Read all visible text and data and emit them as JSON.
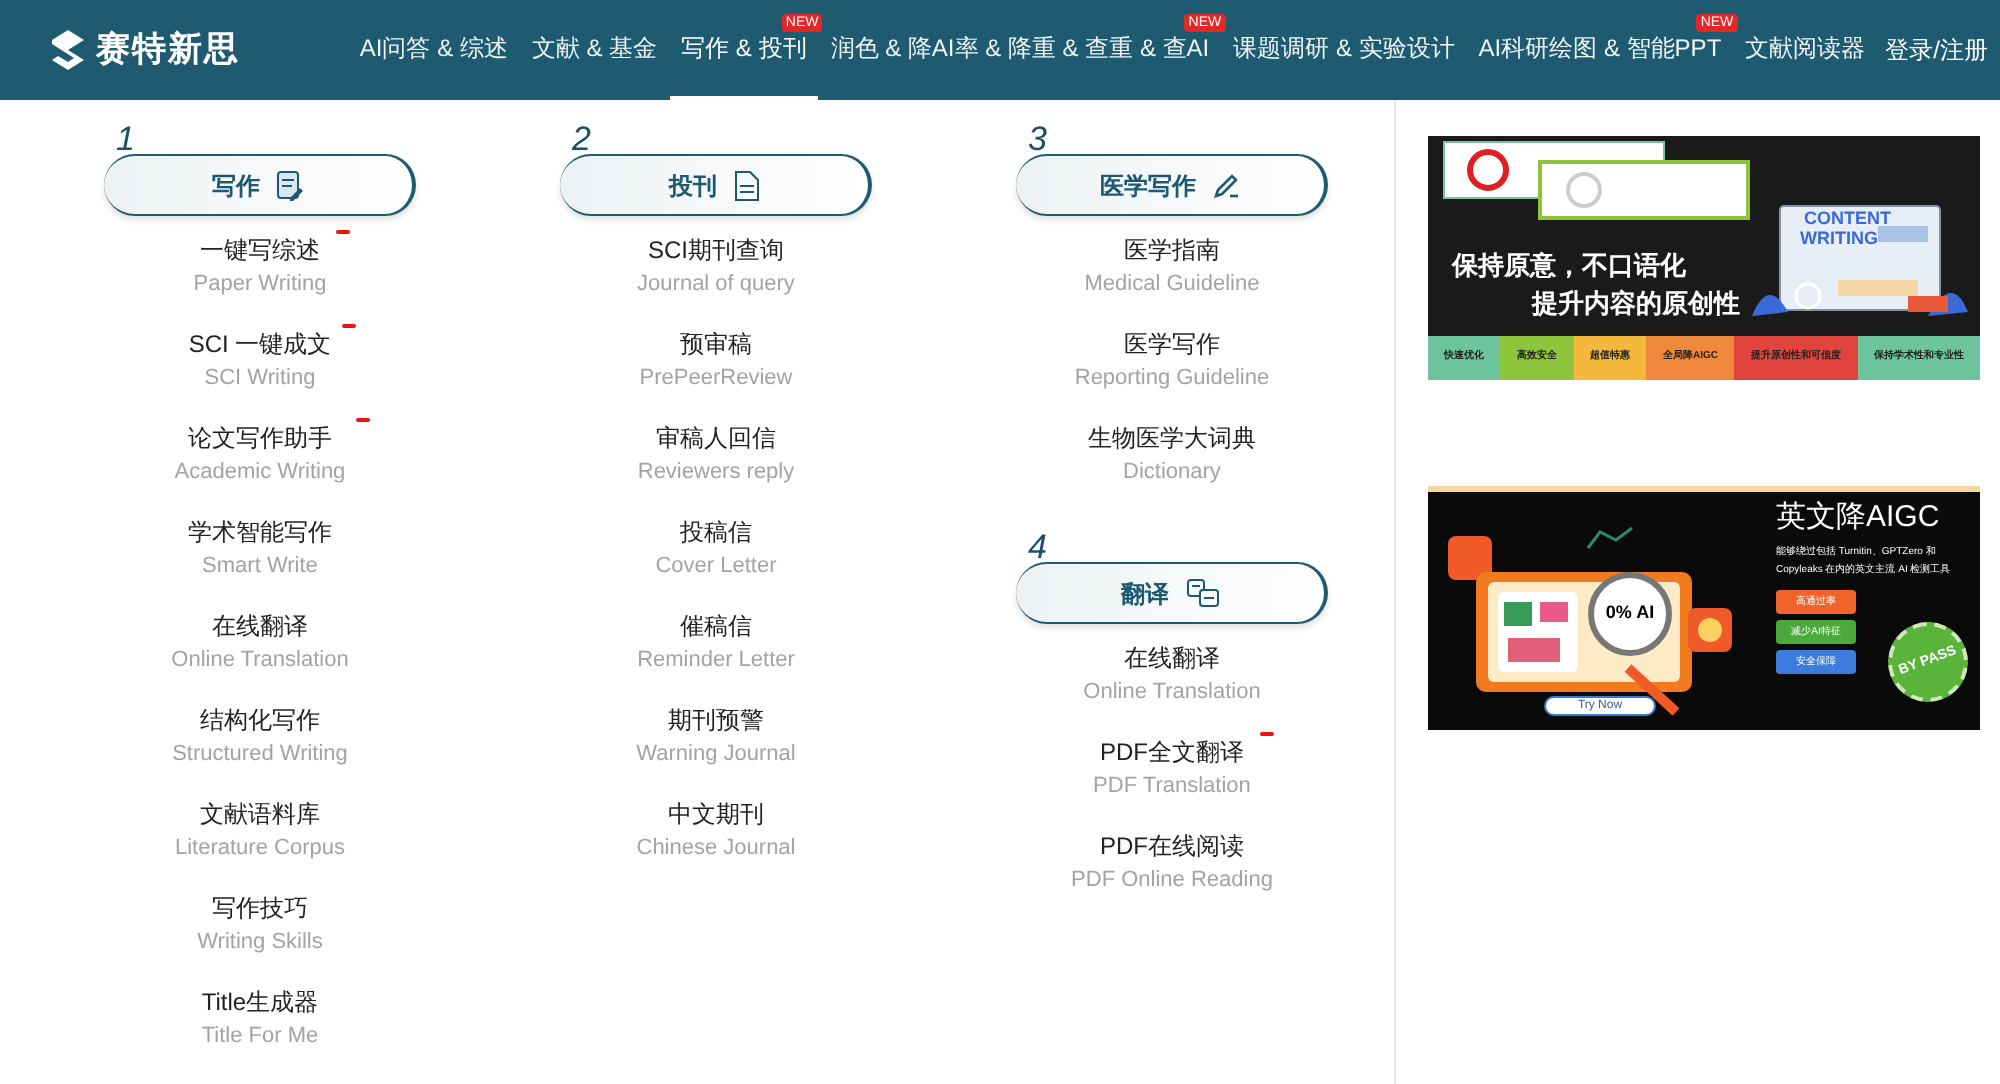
{
  "header": {
    "logo": "赛特新思",
    "nav": [
      {
        "label": "AI问答 & 综述",
        "selected": false
      },
      {
        "label": "文献 & 基金",
        "selected": false
      },
      {
        "label": "写作 & 投刊",
        "selected": true,
        "badge": "NEW"
      },
      {
        "label": "润色 & 降AI率 & 降重 & 查重 & 查AI",
        "selected": false,
        "badge": "NEW"
      },
      {
        "label": "课题调研 & 实验设计",
        "selected": false
      },
      {
        "label": "AI科研绘图 & 智能PPT",
        "selected": false,
        "badge": "NEW"
      },
      {
        "label": "文献阅读器",
        "selected": false
      }
    ],
    "login": "登录/注册"
  },
  "columns": [
    [
      {
        "number": "1",
        "title": "写作",
        "items": [
          {
            "name": "一键写综述",
            "sub": "Paper Writing",
            "new_mark": true
          },
          {
            "name": "SCI 一键成文",
            "sub": "SCI Writing",
            "new_mark": true
          },
          {
            "name": "论文写作助手",
            "sub": "Academic Writing",
            "new_mark": true
          },
          {
            "name": "学术智能写作",
            "sub": "Smart Write",
            "new_mark": false
          },
          {
            "name": "在线翻译",
            "sub": "Online Translation",
            "new_mark": false
          },
          {
            "name": "结构化写作",
            "sub": "Structured Writing",
            "new_mark": false
          },
          {
            "name": "文献语料库",
            "sub": "Literature Corpus",
            "new_mark": false
          },
          {
            "name": "写作技巧",
            "sub": "Writing Skills",
            "new_mark": false
          },
          {
            "name": "Title生成器",
            "sub": "Title For Me",
            "new_mark": false
          }
        ]
      }
    ],
    [
      {
        "number": "2",
        "title": "投刊",
        "items": [
          {
            "name": "SCI期刊查询",
            "sub": "Journal of query",
            "new_mark": false
          },
          {
            "name": "预审稿",
            "sub": "PrePeerReview",
            "new_mark": false
          },
          {
            "name": "审稿人回信",
            "sub": "Reviewers reply",
            "new_mark": false
          },
          {
            "name": "投稿信",
            "sub": "Cover Letter",
            "new_mark": false
          },
          {
            "name": "催稿信",
            "sub": "Reminder Letter",
            "new_mark": false
          },
          {
            "name": "期刊预警",
            "sub": "Warning Journal",
            "new_mark": false
          },
          {
            "name": "中文期刊",
            "sub": "Chinese Journal",
            "new_mark": false
          }
        ]
      }
    ],
    [
      {
        "number": "3",
        "title": "医学写作",
        "items": [
          {
            "name": "医学指南",
            "sub": "Medical Guideline",
            "new_mark": false
          },
          {
            "name": "医学写作",
            "sub": "Reporting Guideline",
            "new_mark": false
          },
          {
            "name": "生物医学大词典",
            "sub": "Dictionary",
            "new_mark": false
          }
        ]
      },
      {
        "number": "4",
        "title": "翻译",
        "items": [
          {
            "name": "在线翻译",
            "sub": "Online Translation",
            "new_mark": false
          },
          {
            "name": "PDF全文翻译",
            "sub": "PDF Translation",
            "new_mark": true
          },
          {
            "name": "PDF在线阅读",
            "sub": "PDF Online Reading",
            "new_mark": false
          }
        ]
      }
    ]
  ],
  "banners": [
    {
      "kind": "content",
      "headline_1": "保持原意，不口语化",
      "headline_2": "提升内容的原创性",
      "screen_title_1": "CONTENT",
      "screen_title_2": "WRITING",
      "tags": [
        {
          "label": "快速优化",
          "color": "#6cc49c"
        },
        {
          "label": "高效安全",
          "color": "#8cc43c"
        },
        {
          "label": "超值特惠",
          "color": "#f4b83c"
        },
        {
          "label": "全局降AIGC",
          "color": "#f0883c"
        },
        {
          "label": "提升原创性和可信度",
          "color": "#e0443c"
        },
        {
          "label": "保持学术性和专业性",
          "color": "#6cc49c"
        }
      ]
    },
    {
      "kind": "aigc",
      "title": "英文降AIGC",
      "text": "能够绕过包括 Turnitin、GPTZero 和 Copyleaks 在内的英文主流 AI 检测工具",
      "lens": "0% AI",
      "cta": "Try Now",
      "seal": "BY PASS",
      "tags": [
        {
          "label": "高通过率",
          "color": "#f0642c"
        },
        {
          "label": "减少AI特征",
          "color": "#4caa3c"
        },
        {
          "label": "安全保障",
          "color": "#3c7cdc"
        }
      ]
    }
  ]
}
